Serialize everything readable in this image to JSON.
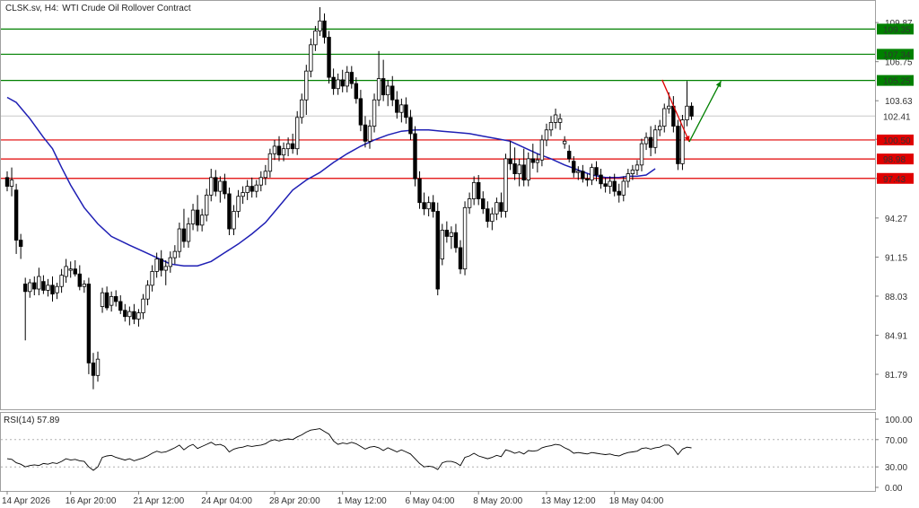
{
  "header": {
    "symbol": "CLSK.sv, H4:",
    "description": "WTI Crude Oil Rollover Contract"
  },
  "colors": {
    "bull": "#000000",
    "bear": "#000000",
    "ma": "#1f1fb4",
    "resistance": "#008000",
    "support": "#e00000",
    "last_price": "#c8c8c8",
    "rsi": "#000000"
  },
  "chart_data": [
    {
      "type": "candlestick",
      "title": "",
      "y_ticks": [
        "109.87",
        "106.75",
        "103.63",
        "100.55",
        "97.43",
        "94.27",
        "91.15",
        "88.03",
        "84.91",
        "81.79"
      ],
      "ylim": [
        79.0,
        111.6
      ],
      "x_ticks": [
        "14 Apr 2026",
        "16 Apr 20:00",
        "21 Apr 12:00",
        "24 Apr 04:00",
        "28 Apr 20:00",
        "1 May 12:00",
        "6 May 04:00",
        "8 May 20:00",
        "13 May 12:00",
        "18 May 04:00"
      ],
      "x_tick_bars": [
        0,
        14,
        29,
        44,
        59,
        74,
        89,
        104,
        119,
        134
      ],
      "candles": [
        [
          97.5,
          98.0,
          96.4,
          96.8
        ],
        [
          96.8,
          98.3,
          96.0,
          97.3
        ],
        [
          96.5,
          97.0,
          91.4,
          92.5
        ],
        [
          92.5,
          93.0,
          91.0,
          92.0
        ],
        [
          89.0,
          89.5,
          84.5,
          88.4
        ],
        [
          88.4,
          89.4,
          87.9,
          89.1
        ],
        [
          89.1,
          89.6,
          88.1,
          88.6
        ],
        [
          88.6,
          90.3,
          88.1,
          89.6
        ],
        [
          89.2,
          89.7,
          88.2,
          88.5
        ],
        [
          88.5,
          89.4,
          88.0,
          88.9
        ],
        [
          88.9,
          89.6,
          87.6,
          88.2
        ],
        [
          88.3,
          89.1,
          87.8,
          88.8
        ],
        [
          88.8,
          90.2,
          88.3,
          89.7
        ],
        [
          89.6,
          91.0,
          89.1,
          90.4
        ],
        [
          90.1,
          90.8,
          89.5,
          90.2
        ],
        [
          90.2,
          90.9,
          89.6,
          89.8
        ],
        [
          89.8,
          90.5,
          88.5,
          88.8
        ],
        [
          88.8,
          89.3,
          88.3,
          89.0
        ],
        [
          89.0,
          89.5,
          81.8,
          82.7
        ],
        [
          82.7,
          83.5,
          80.6,
          81.7
        ],
        [
          81.7,
          83.6,
          81.2,
          83.0
        ],
        [
          87.2,
          88.7,
          86.7,
          88.3
        ],
        [
          88.3,
          88.8,
          86.9,
          87.1
        ],
        [
          87.3,
          88.4,
          86.8,
          88.0
        ],
        [
          88.0,
          88.5,
          87.2,
          87.6
        ],
        [
          87.6,
          88.1,
          86.6,
          86.9
        ],
        [
          86.9,
          87.4,
          86.0,
          86.4
        ],
        [
          86.4,
          87.2,
          85.7,
          86.8
        ],
        [
          86.8,
          87.4,
          85.8,
          86.2
        ],
        [
          86.2,
          87.0,
          85.6,
          86.7
        ],
        [
          86.7,
          88.2,
          86.2,
          87.8
        ],
        [
          87.8,
          89.3,
          87.3,
          88.9
        ],
        [
          88.9,
          90.5,
          88.4,
          90.0
        ],
        [
          90.0,
          91.5,
          89.5,
          91.0
        ],
        [
          91.0,
          91.7,
          89.6,
          90.1
        ],
        [
          90.1,
          90.9,
          88.9,
          90.4
        ],
        [
          90.4,
          91.6,
          89.9,
          91.1
        ],
        [
          91.1,
          92.1,
          90.6,
          91.6
        ],
        [
          91.6,
          93.9,
          91.1,
          93.4
        ],
        [
          93.4,
          95.0,
          91.9,
          92.4
        ],
        [
          92.4,
          94.3,
          91.9,
          93.8
        ],
        [
          93.8,
          95.4,
          93.3,
          94.9
        ],
        [
          94.9,
          96.1,
          93.2,
          93.7
        ],
        [
          93.7,
          95.0,
          93.2,
          94.5
        ],
        [
          94.5,
          96.6,
          94.0,
          96.1
        ],
        [
          96.1,
          98.2,
          95.6,
          97.5
        ],
        [
          97.5,
          98.1,
          96.0,
          96.4
        ],
        [
          96.4,
          97.6,
          95.5,
          97.2
        ],
        [
          97.2,
          97.8,
          95.8,
          96.2
        ],
        [
          96.2,
          96.7,
          92.9,
          93.4
        ],
        [
          93.4,
          95.3,
          92.9,
          94.8
        ],
        [
          94.8,
          96.5,
          94.3,
          96.0
        ],
        [
          96.0,
          96.8,
          95.4,
          96.3
        ],
        [
          96.3,
          97.3,
          95.7,
          96.8
        ],
        [
          96.8,
          97.5,
          95.9,
          96.4
        ],
        [
          96.4,
          97.3,
          95.9,
          96.9
        ],
        [
          96.9,
          98.0,
          96.4,
          97.5
        ],
        [
          97.5,
          98.5,
          96.9,
          98.0
        ],
        [
          98.0,
          99.8,
          97.5,
          99.4
        ],
        [
          99.4,
          100.5,
          98.9,
          100.0
        ],
        [
          100.0,
          100.8,
          98.8,
          99.3
        ],
        [
          99.3,
          100.3,
          98.8,
          99.8
        ],
        [
          99.8,
          100.7,
          99.2,
          100.2
        ],
        [
          100.2,
          101.0,
          99.4,
          99.8
        ],
        [
          99.8,
          102.8,
          99.3,
          102.3
        ],
        [
          102.3,
          104.2,
          101.8,
          103.7
        ],
        [
          103.7,
          106.5,
          102.5,
          106.0
        ],
        [
          106.0,
          108.6,
          105.5,
          108.1
        ],
        [
          108.1,
          109.6,
          107.6,
          109.2
        ],
        [
          109.2,
          111.1,
          108.8,
          110.0
        ],
        [
          110.0,
          110.6,
          108.2,
          108.7
        ],
        [
          108.7,
          109.2,
          105.0,
          105.5
        ],
        [
          105.5,
          106.2,
          104.1,
          104.6
        ],
        [
          104.6,
          105.8,
          104.1,
          105.3
        ],
        [
          105.3,
          106.1,
          104.3,
          104.8
        ],
        [
          104.8,
          106.4,
          104.3,
          105.9
        ],
        [
          105.9,
          106.4,
          104.6,
          105.0
        ],
        [
          105.0,
          105.5,
          103.4,
          103.8
        ],
        [
          103.8,
          104.5,
          101.2,
          101.7
        ],
        [
          101.7,
          102.4,
          99.9,
          100.4
        ],
        [
          100.4,
          102.1,
          99.8,
          101.6
        ],
        [
          101.6,
          104.2,
          101.1,
          103.7
        ],
        [
          103.7,
          107.6,
          103.2,
          105.4
        ],
        [
          105.4,
          106.9,
          103.6,
          104.1
        ],
        [
          104.1,
          105.3,
          103.2,
          104.8
        ],
        [
          104.8,
          105.6,
          103.2,
          103.7
        ],
        [
          103.7,
          104.4,
          102.2,
          102.7
        ],
        [
          102.7,
          103.8,
          101.9,
          103.3
        ],
        [
          103.3,
          103.9,
          101.8,
          102.3
        ],
        [
          102.3,
          102.9,
          100.5,
          101.0
        ],
        [
          101.0,
          101.6,
          96.8,
          97.4
        ],
        [
          97.4,
          98.0,
          95.0,
          95.5
        ],
        [
          95.5,
          96.3,
          94.5,
          95.0
        ],
        [
          95.0,
          96.0,
          94.4,
          95.5
        ],
        [
          95.5,
          96.1,
          94.3,
          94.8
        ],
        [
          94.8,
          95.5,
          88.1,
          88.6
        ],
        [
          91.0,
          93.8,
          90.5,
          93.3
        ],
        [
          93.3,
          94.0,
          92.3,
          92.8
        ],
        [
          92.8,
          93.6,
          91.8,
          93.1
        ],
        [
          93.1,
          93.8,
          91.5,
          91.9
        ],
        [
          91.9,
          92.5,
          89.8,
          90.2
        ],
        [
          90.2,
          95.6,
          89.7,
          95.1
        ],
        [
          95.1,
          96.3,
          94.6,
          95.8
        ],
        [
          95.8,
          97.6,
          95.3,
          97.1
        ],
        [
          97.1,
          97.7,
          95.3,
          95.8
        ],
        [
          95.8,
          96.4,
          94.6,
          95.0
        ],
        [
          95.0,
          95.6,
          93.5,
          94.0
        ],
        [
          94.0,
          95.1,
          93.3,
          94.6
        ],
        [
          94.6,
          95.9,
          94.1,
          95.5
        ],
        [
          95.5,
          96.3,
          94.3,
          94.8
        ],
        [
          94.8,
          99.4,
          94.3,
          99.0
        ],
        [
          99.0,
          100.4,
          98.1,
          98.6
        ],
        [
          98.6,
          99.9,
          97.3,
          97.8
        ],
        [
          97.8,
          99.0,
          96.8,
          98.5
        ],
        [
          98.5,
          99.8,
          96.8,
          97.3
        ],
        [
          97.3,
          99.5,
          96.8,
          99.0
        ],
        [
          99.0,
          100.2,
          98.2,
          98.7
        ],
        [
          98.7,
          99.4,
          97.9,
          98.9
        ],
        [
          98.9,
          100.9,
          98.4,
          100.5
        ],
        [
          100.5,
          101.8,
          100.0,
          101.3
        ],
        [
          101.3,
          102.4,
          100.8,
          101.9
        ],
        [
          101.9,
          103.0,
          101.4,
          102.5
        ],
        [
          101.9,
          102.6,
          101.3,
          102.2
        ],
        [
          100.2,
          100.8,
          99.8,
          100.4
        ],
        [
          99.6,
          100.1,
          98.7,
          99.0
        ],
        [
          98.8,
          99.2,
          97.5,
          97.9
        ],
        [
          97.9,
          98.4,
          97.3,
          98.0
        ],
        [
          98.0,
          98.5,
          97.1,
          97.4
        ],
        [
          97.4,
          97.8,
          96.8,
          97.3
        ],
        [
          97.3,
          98.6,
          96.9,
          98.3
        ],
        [
          98.3,
          98.8,
          97.2,
          97.7
        ],
        [
          97.7,
          98.2,
          96.6,
          97.0
        ],
        [
          97.0,
          97.5,
          96.3,
          96.8
        ],
        [
          96.8,
          97.6,
          96.2,
          97.2
        ],
        [
          97.2,
          97.8,
          96.0,
          96.4
        ],
        [
          96.4,
          97.0,
          95.5,
          96.1
        ],
        [
          96.1,
          97.6,
          95.6,
          97.2
        ],
        [
          97.2,
          98.2,
          96.7,
          97.8
        ],
        [
          97.8,
          98.5,
          97.3,
          98.1
        ],
        [
          98.1,
          98.9,
          97.7,
          98.5
        ],
        [
          98.5,
          100.6,
          98.0,
          100.2
        ],
        [
          100.2,
          101.1,
          99.7,
          100.7
        ],
        [
          100.7,
          101.6,
          99.2,
          99.9
        ],
        [
          99.9,
          101.7,
          99.4,
          101.3
        ],
        [
          101.3,
          102.1,
          100.8,
          101.6
        ],
        [
          101.6,
          103.4,
          101.1,
          103.0
        ],
        [
          103.0,
          104.3,
          102.6,
          103.2
        ],
        [
          103.2,
          104.0,
          101.1,
          101.6
        ],
        [
          101.6,
          102.1,
          98.1,
          98.6
        ],
        [
          98.6,
          102.5,
          98.1,
          102.1
        ],
        [
          102.1,
          105.2,
          101.6,
          103.2
        ],
        [
          103.2,
          103.5,
          102.1,
          102.4
        ]
      ],
      "moving_average": {
        "x": [
          0,
          2,
          5,
          8,
          10,
          12,
          14,
          17,
          20,
          23,
          27,
          30,
          33,
          36,
          39,
          42,
          45,
          48,
          51,
          54,
          57,
          60,
          63,
          66,
          69,
          72,
          75,
          78,
          81,
          84,
          87,
          90,
          93,
          96,
          99,
          102,
          105,
          108,
          111,
          114,
          117,
          120,
          123,
          126,
          129,
          132,
          135,
          137,
          139,
          141,
          143
        ],
        "y": [
          103.9,
          103.5,
          102.2,
          100.7,
          99.8,
          98.3,
          96.9,
          95.1,
          93.8,
          92.8,
          92.1,
          91.6,
          91.1,
          90.6,
          90.45,
          90.45,
          90.8,
          91.5,
          92.2,
          93.0,
          93.9,
          95.2,
          96.5,
          97.3,
          97.9,
          98.7,
          99.4,
          100.0,
          100.5,
          100.9,
          101.2,
          101.3,
          101.3,
          101.2,
          101.1,
          101.0,
          100.8,
          100.6,
          100.4,
          99.9,
          99.4,
          99.0,
          98.5,
          98.1,
          97.7,
          97.5,
          97.5,
          97.6,
          97.6,
          97.7,
          98.2
        ]
      },
      "horizontal_levels": [
        {
          "value": 109.35,
          "label": "109.35",
          "kind": "resistance"
        },
        {
          "value": 107.34,
          "label": "107.34",
          "kind": "resistance"
        },
        {
          "value": 105.25,
          "label": "105.25",
          "kind": "resistance"
        },
        {
          "value": 100.5,
          "label": "100.50",
          "kind": "support"
        },
        {
          "value": 98.98,
          "label": "98.98",
          "kind": "support"
        },
        {
          "value": 97.43,
          "label": "97.43",
          "kind": "support"
        }
      ],
      "last_price": {
        "value": 102.41,
        "label": "102.41"
      },
      "projection": {
        "down": {
          "from": [
            144.5,
            105.3
          ],
          "to": [
            150.5,
            100.35
          ]
        },
        "up": {
          "from": [
            150.5,
            100.35
          ],
          "to": [
            157.5,
            105.2
          ]
        }
      }
    },
    {
      "type": "line",
      "title": "RSI(14) 57.89",
      "y_ticks": [
        "100.00",
        "70.00",
        "30.00",
        "0.00"
      ],
      "levels": [
        70,
        30
      ],
      "ylim": [
        0,
        100
      ],
      "series": [
        {
          "values": [
            42,
            41,
            36,
            34,
            30,
            32,
            33,
            32,
            35,
            34,
            36,
            35,
            38,
            42,
            40,
            41,
            39,
            38,
            30,
            25,
            30,
            44,
            46,
            47,
            44,
            42,
            40,
            42,
            39,
            41,
            43,
            46,
            50,
            53,
            51,
            52,
            55,
            58,
            62,
            55,
            60,
            63,
            57,
            60,
            63,
            66,
            62,
            63,
            60,
            52,
            56,
            58,
            59,
            61,
            60,
            61,
            62,
            64,
            68,
            70,
            68,
            70,
            71,
            70,
            74,
            77,
            81,
            84,
            85,
            86,
            82,
            78,
            68,
            63,
            65,
            64,
            66,
            64,
            60,
            56,
            59,
            60,
            58,
            54,
            58,
            55,
            52,
            55,
            52,
            49,
            42,
            35,
            30,
            31,
            30,
            26,
            36,
            38,
            38,
            36,
            32,
            44,
            46,
            50,
            46,
            44,
            42,
            44,
            47,
            45,
            55,
            53,
            50,
            52,
            49,
            54,
            53,
            54,
            58,
            60,
            61,
            63,
            62,
            58,
            55,
            50,
            51,
            50,
            49,
            51,
            50,
            49,
            48,
            49,
            47,
            46,
            49,
            51,
            52,
            53,
            57,
            58,
            56,
            58,
            59,
            62,
            62,
            57,
            48,
            56,
            59,
            57.9
          ]
        }
      ]
    }
  ]
}
